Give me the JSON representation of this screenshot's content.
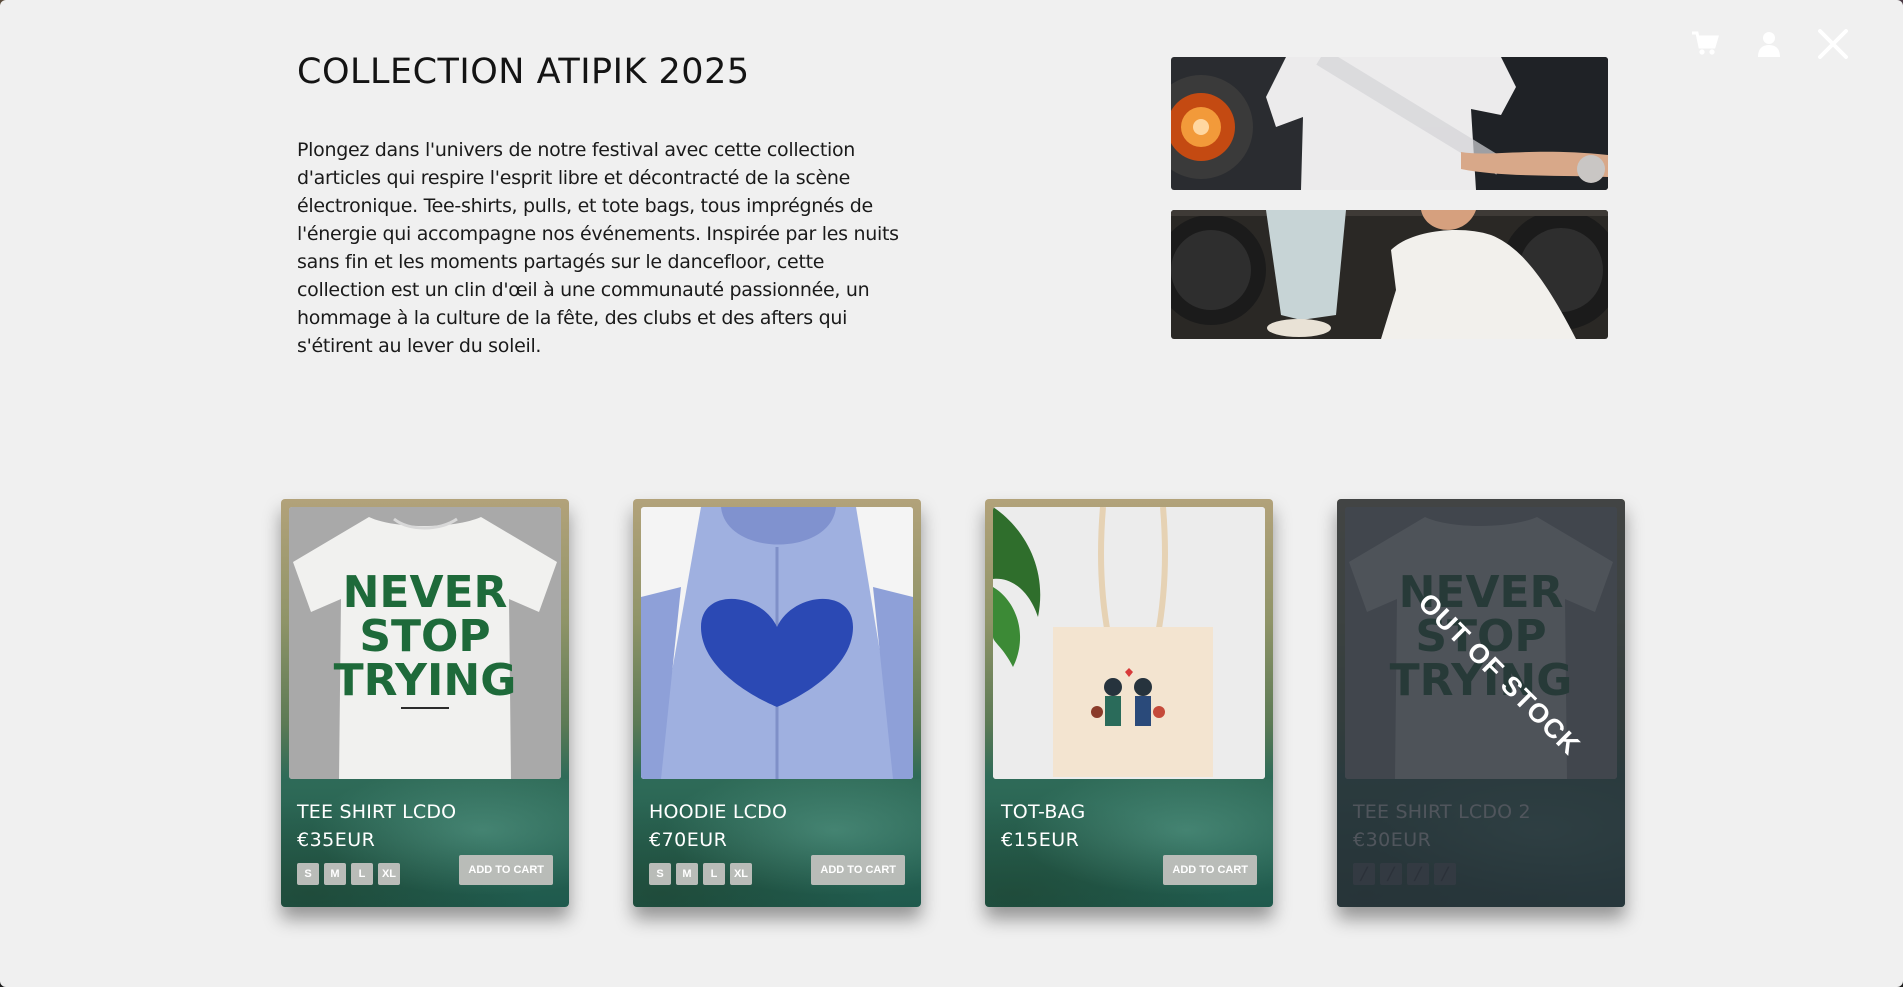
{
  "header": {
    "icons": [
      "cart-icon",
      "user-icon",
      "close-icon"
    ]
  },
  "intro": {
    "title": "COLLECTION ATIPIK 2025",
    "description": "Plongez dans l'univers de notre festival avec cette collection d'articles qui respire l'esprit libre et décontracté de la scène électronique. Tee-shirts, pulls, et tote bags, tous imprégnés de l'énergie qui accompagne nos événements. Inspirée par les nuits sans fin et les moments partagés sur le dancefloor, cette collection est un clin d'œil à une communauté passionnée, un hommage à la culture de la fête, des clubs et des afters qui s'étirent au lever du soleil."
  },
  "products": [
    {
      "name": "TEE SHIRT LCDO",
      "price": "€35EUR",
      "sizes": [
        "S",
        "M",
        "L",
        "XL"
      ],
      "add_to_cart": "ADD TO CART",
      "in_stock": true
    },
    {
      "name": "HOODIE LCDO",
      "price": "€70EUR",
      "sizes": [
        "S",
        "M",
        "L",
        "XL"
      ],
      "add_to_cart": "ADD TO CART",
      "in_stock": true
    },
    {
      "name": "TOT-BAG",
      "price": "€15EUR",
      "sizes": [],
      "add_to_cart": "ADD TO CART",
      "in_stock": true
    },
    {
      "name": "TEE SHIRT LCDO 2",
      "price": "€30EUR",
      "sizes": [
        "",
        "",
        "",
        ""
      ],
      "in_stock": false,
      "badge": "OUT OF STOCK"
    }
  ],
  "colors": {
    "modal_bg": "#f0f0f0",
    "card_green": "#1f5a4d",
    "button_grey": "#b9bcb8",
    "tee_print_green": "#1e6a3a",
    "hoodie_blue": "#9fb0e0"
  }
}
